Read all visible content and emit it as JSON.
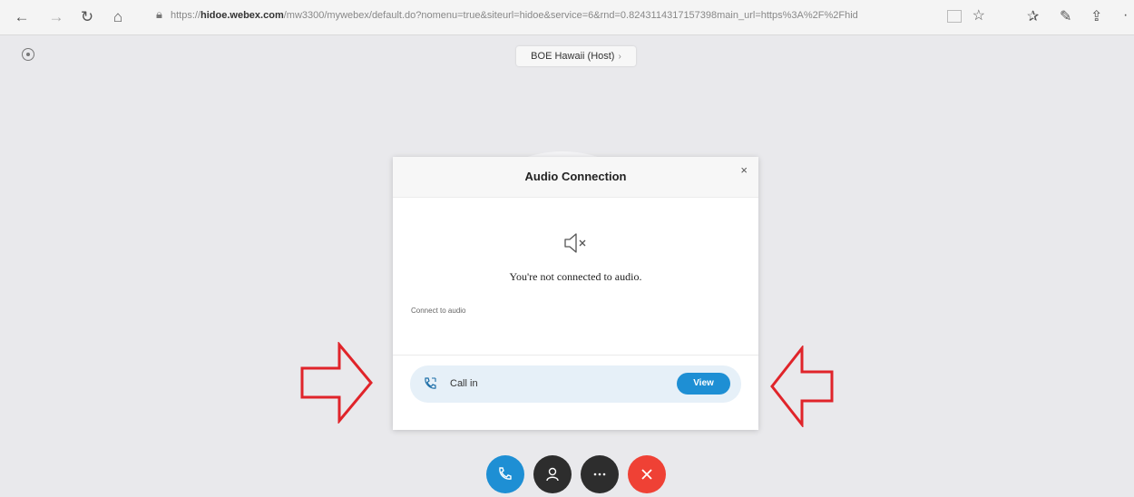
{
  "browser": {
    "url_prefix": "https://",
    "url_host": "hidoe.webex.com",
    "url_path": "/mw3300/mywebex/default.do?nomenu=true&siteurl=hidoe&service=6&rnd=0.8243114317157398main_url=https%3A%2F%2Fhid",
    "icons": [
      "back-icon",
      "forward-icon",
      "refresh-icon",
      "home-icon",
      "lock-icon",
      "reading-view-icon",
      "favorite-star-icon",
      "favorites-icon",
      "notes-icon",
      "share-icon",
      "more-icon"
    ]
  },
  "meeting": {
    "title": "BOE Hawaii (Host)",
    "caret": "›"
  },
  "dialog": {
    "title": "Audio Connection",
    "close": "×",
    "status": "You're not connected to audio.",
    "section_label": "Connect to audio",
    "option_label": "Call in",
    "view_button": "View"
  },
  "annotations": {
    "arrow_color": "#e0242a"
  },
  "controls": [
    {
      "name": "audio",
      "color": "#1e8fd4"
    },
    {
      "name": "participants",
      "color": "#2d2d2d"
    },
    {
      "name": "more",
      "color": "#2d2d2d"
    },
    {
      "name": "end",
      "color": "#ef4135"
    }
  ],
  "colors": {
    "accent": "#1e8fd4",
    "end_call": "#ef4135",
    "callin_background": "#e6f0f8"
  }
}
